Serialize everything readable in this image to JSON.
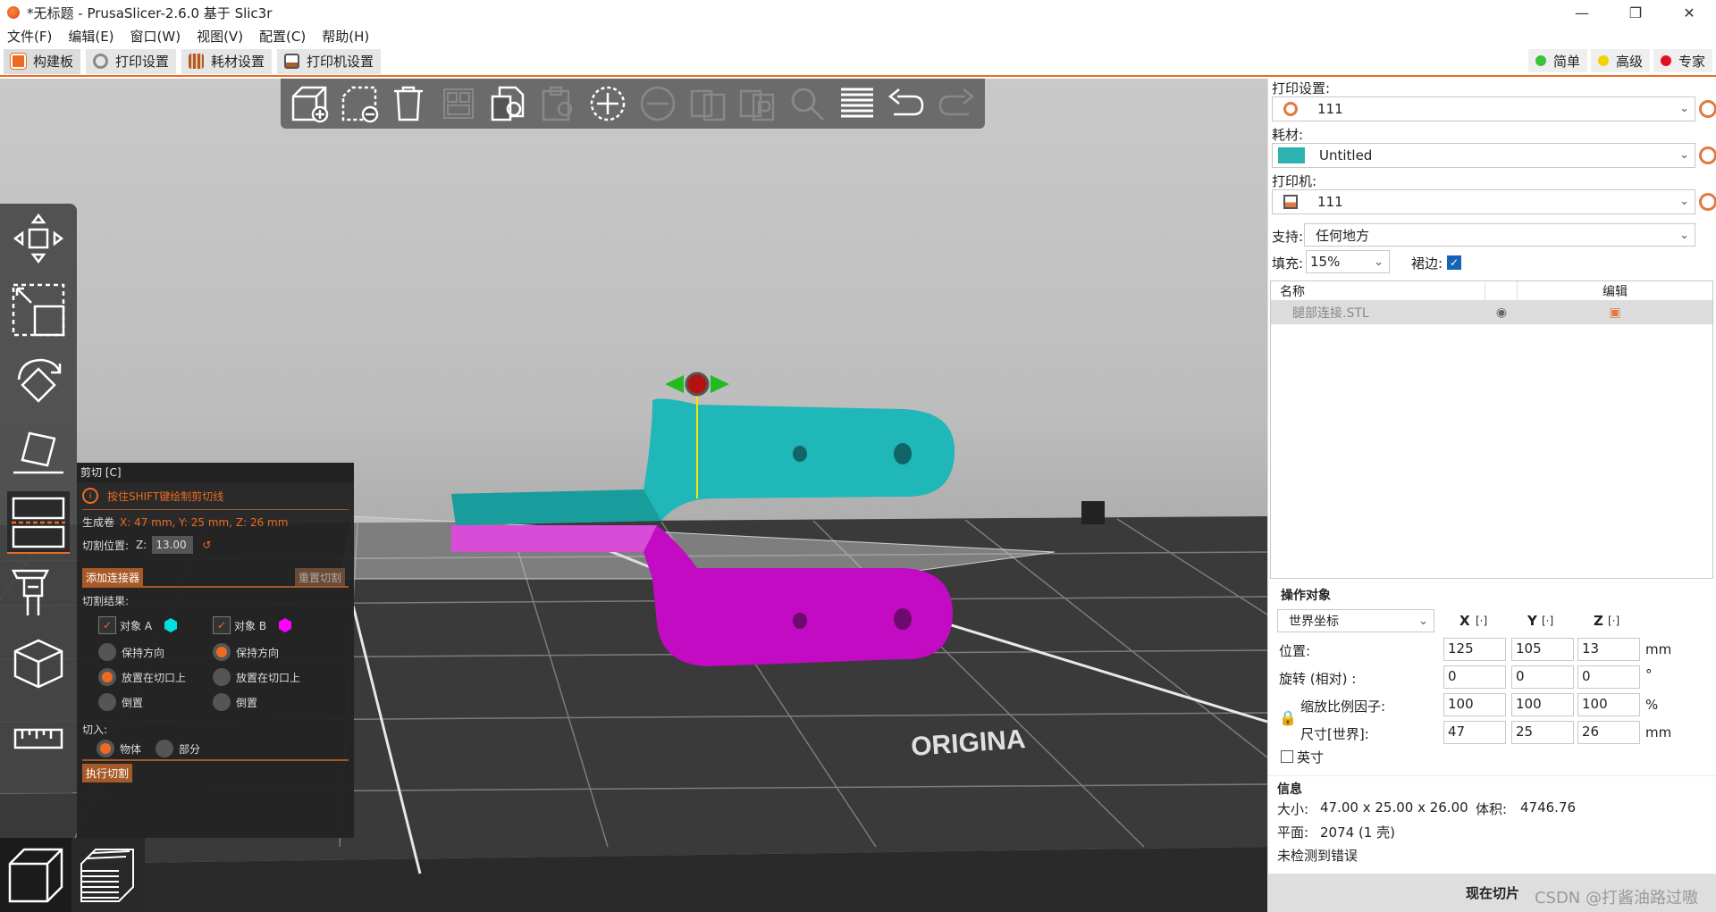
{
  "window": {
    "title": "*无标题 - PrusaSlicer-2.6.0 基于 Slic3r"
  },
  "menu": [
    "文件(F)",
    "编辑(E)",
    "窗口(W)",
    "视图(V)",
    "配置(C)",
    "帮助(H)"
  ],
  "tabs": [
    {
      "label": "构建板",
      "color": "#ed6b21"
    },
    {
      "label": "打印设置",
      "color": "#8a8a8a"
    },
    {
      "label": "耗材设置",
      "color": "#b05a2a"
    },
    {
      "label": "打印机设置",
      "color": "#b05a2a"
    }
  ],
  "modes": [
    {
      "label": "简单",
      "color": "#3cc33c"
    },
    {
      "label": "高级",
      "color": "#f2d400"
    },
    {
      "label": "专家",
      "color": "#e0121e"
    }
  ],
  "cut_panel": {
    "title": "剪切 [C]",
    "hint": "按住SHIFT键绘制剪切线",
    "build_volume_label": "生成卷",
    "build_volume_value": "X: 47 mm, Y: 25 mm, Z: 26 mm",
    "cut_position_label": "切割位置:",
    "z_label": "Z:",
    "z_value": "13.00",
    "add_connector": "添加连接器",
    "reset_cut": "重置切割",
    "result_label": "切割结果:",
    "object_a": "对象 A",
    "object_b": "对象 B",
    "object_a_color": "#00e0e0",
    "object_b_color": "#ff00ff",
    "keep_orientation": "保持方向",
    "place_on_cut": "放置在切口上",
    "flip": "倒置",
    "cut_into_label": "切入:",
    "object_option": "物体",
    "part_option": "部分",
    "perform_cut": "执行切割"
  },
  "right": {
    "print_settings_label": "打印设置:",
    "print_settings_value": "111",
    "filament_label": "耗材:",
    "filament_value": "Untitled",
    "filament_color": "#2db2b2",
    "printer_label": "打印机:",
    "printer_value": "111",
    "support_label": "支持:",
    "support_value": "任何地方",
    "infill_label": "填充:",
    "infill_value": "15%",
    "brim_label": "裙边:",
    "list_header_name": "名称",
    "list_header_edit": "编辑",
    "object_name": "腿部连接.STL",
    "manip_title": "操作对象",
    "coord_value": "世界坐标",
    "axes": [
      "X",
      "Y",
      "Z"
    ],
    "position_label": "位置:",
    "position": [
      "125",
      "105",
      "13"
    ],
    "position_unit": "mm",
    "rotation_label": "旋转 (相对) :",
    "rotation": [
      "0",
      "0",
      "0"
    ],
    "rotation_unit": "°",
    "scale_label": "缩放比例因子:",
    "scale": [
      "100",
      "100",
      "100"
    ],
    "scale_unit": "%",
    "size_label": "尺寸[世界]:",
    "size": [
      "47",
      "25",
      "26"
    ],
    "size_unit": "mm",
    "inches_label": "英寸",
    "info_title": "信息",
    "size_info_label": "大小:",
    "size_info_value": "47.00 x 25.00 x 26.00",
    "volume_label": "体积:",
    "volume_value": "4746.76",
    "facets_label": "平面:",
    "facets_value": "2074 (1 壳)",
    "errors_text": "未检测到错误",
    "slice_button": "现在切片"
  },
  "watermark": "CSDN @打酱油路过嗷",
  "bed_text": "ORIGINA"
}
